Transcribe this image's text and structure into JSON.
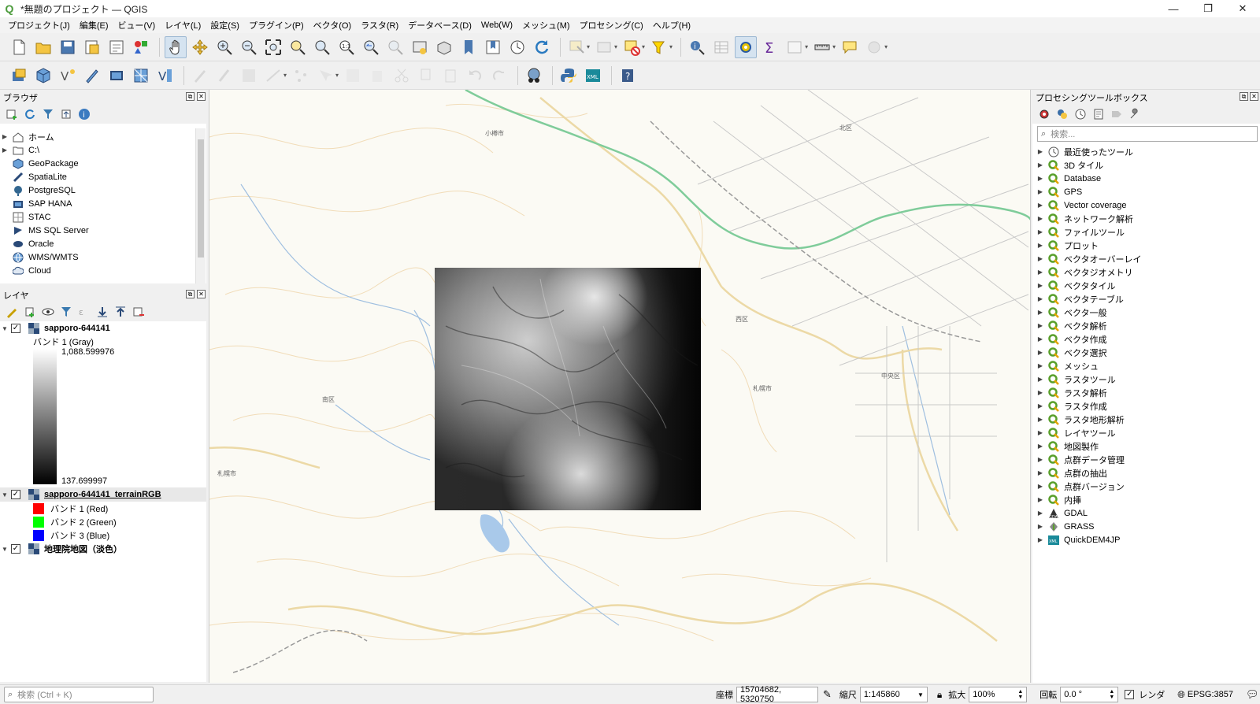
{
  "window": {
    "title": "*無題のプロジェクト — QGIS"
  },
  "menu": [
    "プロジェクト(J)",
    "編集(E)",
    "ビュー(V)",
    "レイヤ(L)",
    "設定(S)",
    "プラグイン(P)",
    "ベクタ(O)",
    "ラスタ(R)",
    "データベース(D)",
    "Web(W)",
    "メッシュ(M)",
    "プロセシング(C)",
    "ヘルプ(H)"
  ],
  "browser": {
    "title": "ブラウザ",
    "items": [
      {
        "label": "ホーム",
        "icon": "home-icon",
        "expand": true
      },
      {
        "label": "C:\\",
        "icon": "folder-icon",
        "expand": true
      },
      {
        "label": "GeoPackage",
        "icon": "geopackage-icon",
        "expand": false
      },
      {
        "label": "SpatiaLite",
        "icon": "spatialite-icon",
        "expand": false
      },
      {
        "label": "PostgreSQL",
        "icon": "postgresql-icon",
        "expand": false
      },
      {
        "label": "SAP HANA",
        "icon": "sap-hana-icon",
        "expand": false
      },
      {
        "label": "STAC",
        "icon": "stac-icon",
        "expand": false
      },
      {
        "label": "MS SQL Server",
        "icon": "mssql-icon",
        "expand": false
      },
      {
        "label": "Oracle",
        "icon": "oracle-icon",
        "expand": false
      },
      {
        "label": "WMS/WMTS",
        "icon": "wms-icon",
        "expand": false
      },
      {
        "label": "Cloud",
        "icon": "cloud-icon",
        "expand": false
      }
    ]
  },
  "layers": {
    "title": "レイヤ",
    "layer1": {
      "name": "sapporo-644141",
      "band": "バンド 1 (Gray)",
      "max": "1,088.599976",
      "min": "137.699997"
    },
    "layer2": {
      "name": "sapporo-644141_terrainRGB",
      "bands": [
        {
          "label": "バンド 1 (Red)",
          "color": "#ff0000"
        },
        {
          "label": "バンド 2 (Green)",
          "color": "#00ff00"
        },
        {
          "label": "バンド 3 (Blue)",
          "color": "#0000ff"
        }
      ]
    },
    "layer3": {
      "name": "地理院地図（淡色）"
    }
  },
  "processing": {
    "title": "プロセシングツールボックス",
    "search_placeholder": "検索...",
    "items": [
      {
        "label": "最近使ったツール",
        "icon": "clock-icon"
      },
      {
        "label": "3D タイル",
        "icon": "qgis-icon"
      },
      {
        "label": "Database",
        "icon": "qgis-icon"
      },
      {
        "label": "GPS",
        "icon": "qgis-icon"
      },
      {
        "label": "Vector coverage",
        "icon": "qgis-icon"
      },
      {
        "label": "ネットワーク解析",
        "icon": "qgis-icon"
      },
      {
        "label": "ファイルツール",
        "icon": "qgis-icon"
      },
      {
        "label": "プロット",
        "icon": "qgis-icon"
      },
      {
        "label": "ベクタオーバーレイ",
        "icon": "qgis-icon"
      },
      {
        "label": "ベクタジオメトリ",
        "icon": "qgis-icon"
      },
      {
        "label": "ベクタタイル",
        "icon": "qgis-icon"
      },
      {
        "label": "ベクタテーブル",
        "icon": "qgis-icon"
      },
      {
        "label": "ベクタ一般",
        "icon": "qgis-icon"
      },
      {
        "label": "ベクタ解析",
        "icon": "qgis-icon"
      },
      {
        "label": "ベクタ作成",
        "icon": "qgis-icon"
      },
      {
        "label": "ベクタ選択",
        "icon": "qgis-icon"
      },
      {
        "label": "メッシュ",
        "icon": "qgis-icon"
      },
      {
        "label": "ラスタツール",
        "icon": "qgis-icon"
      },
      {
        "label": "ラスタ解析",
        "icon": "qgis-icon"
      },
      {
        "label": "ラスタ作成",
        "icon": "qgis-icon"
      },
      {
        "label": "ラスタ地形解析",
        "icon": "qgis-icon"
      },
      {
        "label": "レイヤツール",
        "icon": "qgis-icon"
      },
      {
        "label": "地図製作",
        "icon": "qgis-icon"
      },
      {
        "label": "点群データ管理",
        "icon": "qgis-icon"
      },
      {
        "label": "点群の抽出",
        "icon": "qgis-icon"
      },
      {
        "label": "点群バージョン",
        "icon": "qgis-icon"
      },
      {
        "label": "内挿",
        "icon": "qgis-icon"
      },
      {
        "label": "GDAL",
        "icon": "gdal-icon"
      },
      {
        "label": "GRASS",
        "icon": "grass-icon"
      },
      {
        "label": "QuickDEM4JP",
        "icon": "xml-plugin-icon"
      }
    ]
  },
  "map_labels": {
    "otaru": "小樽市",
    "nishi": "西区",
    "minami": "南区",
    "sapporo": "札幌市",
    "chuo": "中央区",
    "kita": "北区",
    "sapporo2": "札幌市"
  },
  "status": {
    "search_placeholder": "検索 (Ctrl + K)",
    "coord_label": "座標",
    "coord_value": "15704682, 5320750",
    "scale_label": "縮尺",
    "scale_value": "1:145860",
    "magnify_label": "拡大",
    "magnify_value": "100%",
    "rotation_label": "回転",
    "rotation_value": "0.0 °",
    "render_label": "レンダ",
    "crs_value": "EPSG:3857"
  }
}
